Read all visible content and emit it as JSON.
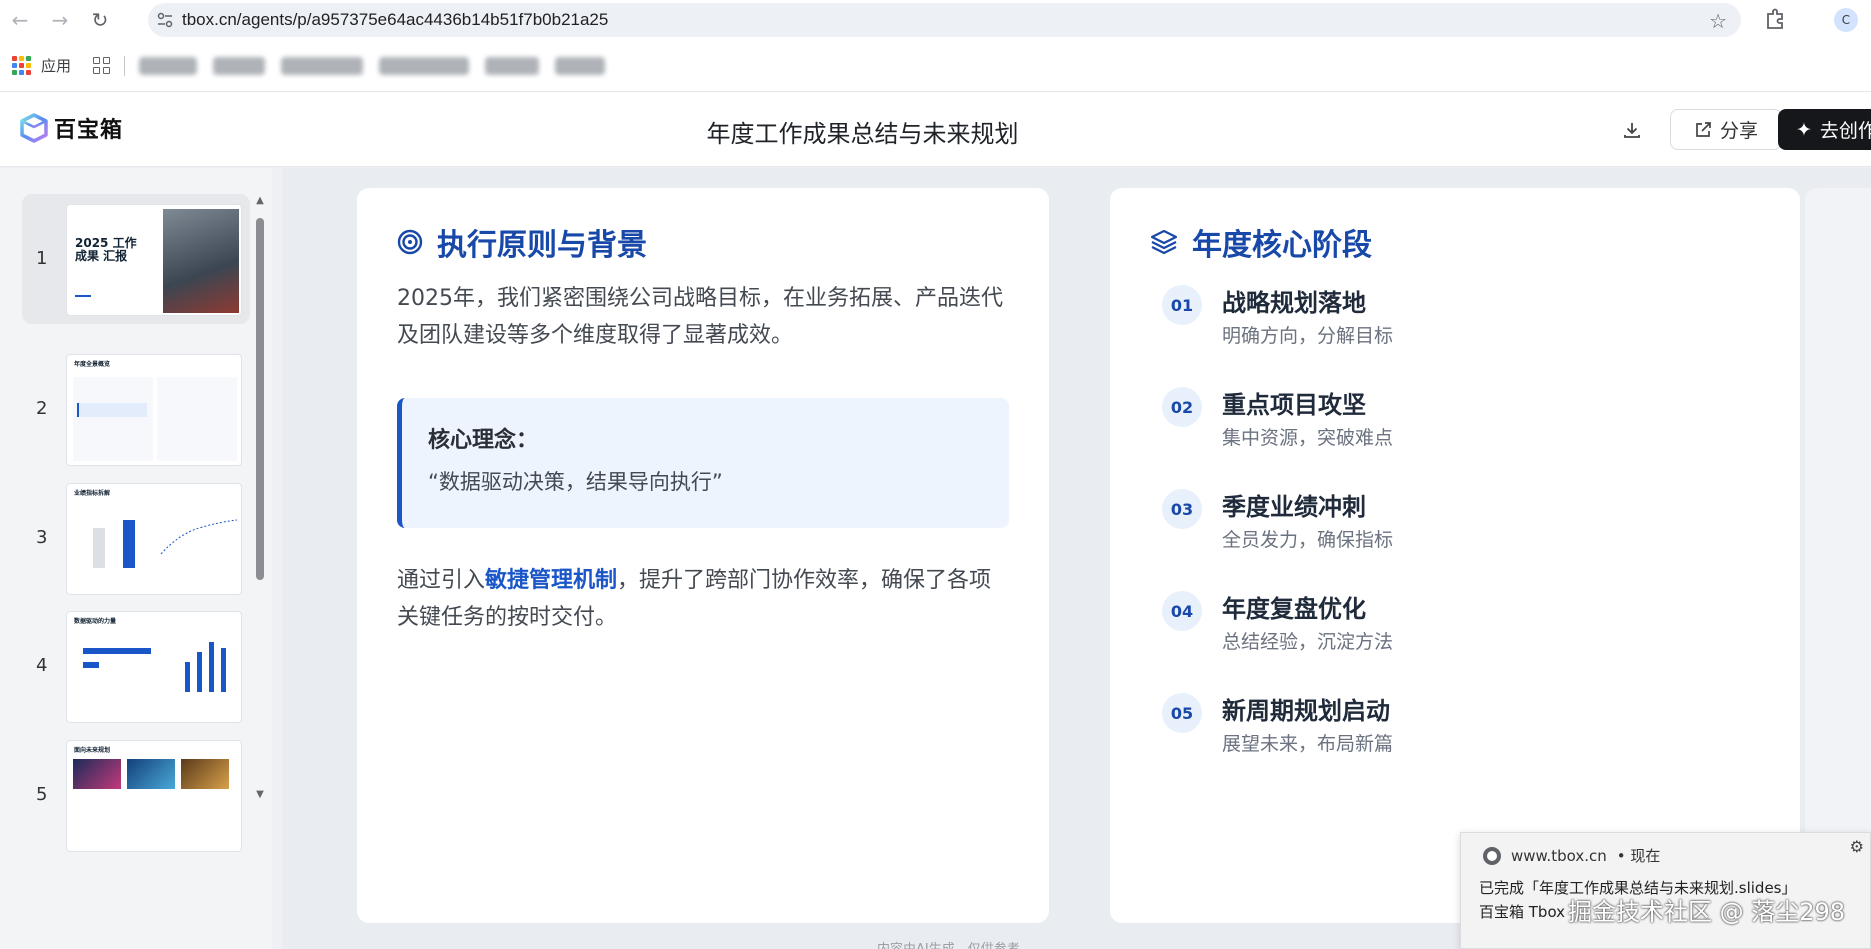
{
  "browser": {
    "url": "tbox.cn/agents/p/a957375e64ac4436b14b51f7b0b21a25",
    "profile_initial": "C",
    "bookmarks": {
      "apps_label": "应用"
    }
  },
  "app": {
    "logo_text": "百宝箱",
    "doc_title": "年度工作成果总结与未来规划",
    "share_label": "分享",
    "create_label": "去创作"
  },
  "sidebar": {
    "thumbnails": [
      {
        "num": "1",
        "title": "2025 工作成果 汇报",
        "year": "2025"
      },
      {
        "num": "2",
        "title": "年度全景概览"
      },
      {
        "num": "3",
        "title": "业绩指标拆解"
      },
      {
        "num": "4",
        "title": "数据驱动的力量"
      },
      {
        "num": "5",
        "title": "面向未来规划"
      }
    ]
  },
  "slide": {
    "left": {
      "heading": "执行原则与背景",
      "para1": "2025年，我们紧密围绕公司战略目标，在业务拓展、产品迭代及团队建设等多个维度取得了显著成效。",
      "quote_title": "核心理念：",
      "quote_text": "“数据驱动决策，结果导向执行”",
      "para2_before": "通过引入",
      "para2_highlight": "敏捷管理机制",
      "para2_after": "，提升了跨部门协作效率，确保了各项关键任务的按时交付。"
    },
    "right": {
      "heading": "年度核心阶段",
      "stages": [
        {
          "num": "01",
          "title": "战略规划落地",
          "desc": "明确方向，分解目标"
        },
        {
          "num": "02",
          "title": "重点项目攻坚",
          "desc": "集中资源，突破难点"
        },
        {
          "num": "03",
          "title": "季度业绩冲刺",
          "desc": "全员发力，确保指标"
        },
        {
          "num": "04",
          "title": "年度复盘优化",
          "desc": "总结经验，沉淀方法"
        },
        {
          "num": "05",
          "title": "新周期规划启动",
          "desc": "展望未来，布局新篇"
        }
      ]
    },
    "ai_note": "内容由AI生成，仅供参考"
  },
  "notification": {
    "source": "www.tbox.cn",
    "time": "• 现在",
    "line1": "已完成「年度工作成果总结与未来规划.slides」",
    "line2": "百宝箱 Tbox"
  },
  "watermark": "掘金技术社区 @ 落尘298",
  "colors": {
    "accent": "#1a56c8",
    "heading": "#1848a8",
    "quote_bg": "#eef4fd"
  }
}
